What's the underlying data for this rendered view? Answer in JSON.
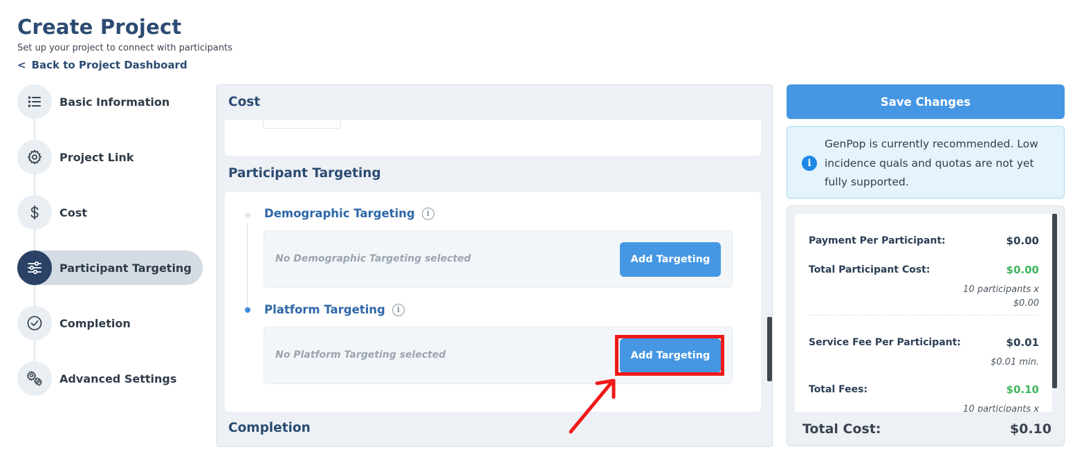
{
  "header": {
    "title": "Create Project",
    "subtitle": "Set up your project to connect with participants",
    "back_link": "Back to Project Dashboard"
  },
  "sidebar": {
    "steps": [
      {
        "label": "Basic Information",
        "icon": "list-icon"
      },
      {
        "label": "Project Link",
        "icon": "gear-icon"
      },
      {
        "label": "Cost",
        "icon": "dollar-icon"
      },
      {
        "label": "Participant Targeting",
        "icon": "sliders-icon",
        "active": true
      },
      {
        "label": "Completion",
        "icon": "check-circle-icon"
      },
      {
        "label": "Advanced Settings",
        "icon": "gears-icon"
      }
    ]
  },
  "main": {
    "cost_title": "Cost",
    "targeting_title": "Participant Targeting",
    "completion_title": "Completion",
    "demographic": {
      "title": "Demographic Targeting",
      "empty_text": "No Demographic Targeting selected",
      "button": "Add Targeting"
    },
    "platform": {
      "title": "Platform Targeting",
      "empty_text": "No Platform Targeting selected",
      "button": "Add Targeting"
    }
  },
  "right": {
    "save_button": "Save Changes",
    "notice": "GenPop is currently recommended. Low incidence quals and quotas are not yet fully supported.",
    "summary": {
      "payment_per_participant_label": "Payment Per Participant:",
      "payment_per_participant_value": "$0.00",
      "total_participant_cost_label": "Total Participant Cost:",
      "total_participant_cost_value": "$0.00",
      "total_participant_cost_note_1": "10 participants x",
      "total_participant_cost_note_2": "$0.00",
      "service_fee_label": "Service Fee Per Participant:",
      "service_fee_value": "$0.01",
      "service_fee_note": "$0.01 min.",
      "total_fees_label": "Total Fees:",
      "total_fees_value": "$0.10",
      "total_fees_note": "10 participants x",
      "total_cost_label": "Total Cost:",
      "total_cost_value": "$0.10"
    }
  },
  "colors": {
    "primary": "#4697e3",
    "title": "#2b4b72",
    "active_step": "#2b4266",
    "highlight": "#f01818",
    "green": "#3fb55c"
  }
}
